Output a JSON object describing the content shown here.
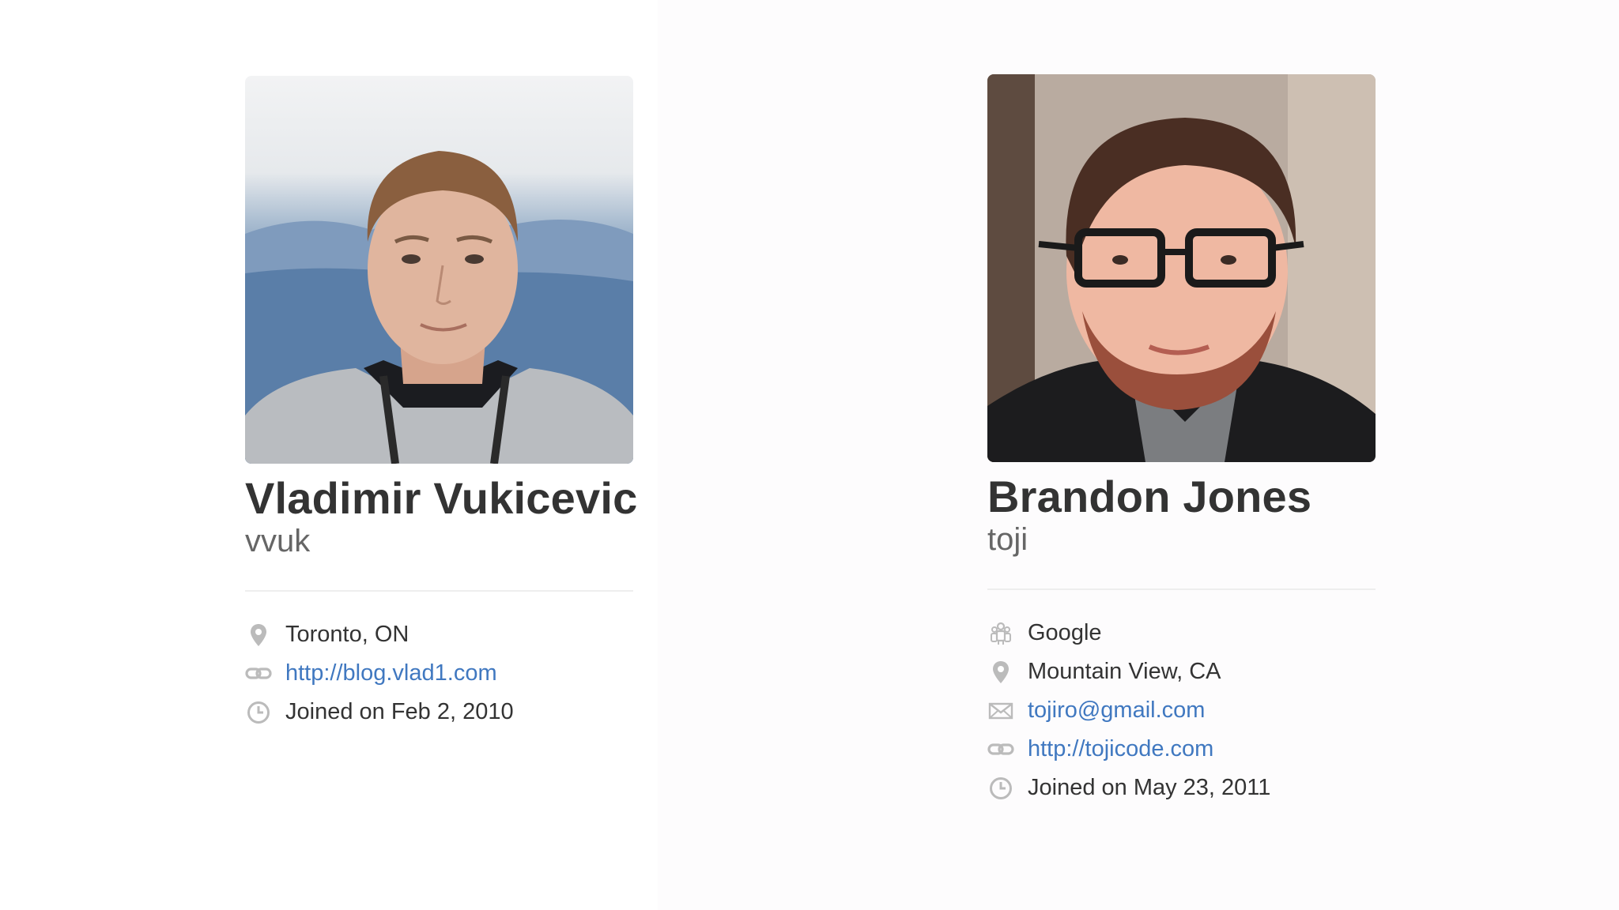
{
  "profiles": [
    {
      "fullname": "Vladimir Vukicevic",
      "username": "vvuk",
      "location": "Toronto, ON",
      "url": "http://blog.vlad1.com",
      "joined": "Joined on Feb 2, 2010",
      "icons": {
        "location": "location-pin-icon",
        "url": "link-icon",
        "joined": "clock-icon"
      }
    },
    {
      "fullname": "Brandon Jones",
      "username": "toji",
      "organization": "Google",
      "location": "Mountain View, CA",
      "email": "tojiro@gmail.com",
      "url": "http://tojicode.com",
      "joined": "Joined on May 23, 2011",
      "icons": {
        "organization": "organization-icon",
        "location": "location-pin-icon",
        "email": "mail-icon",
        "url": "link-icon",
        "joined": "clock-icon"
      }
    }
  ],
  "colors": {
    "link": "#4078c0",
    "text": "#333333",
    "muted": "#666666",
    "icon": "#bbbbbb",
    "divider": "#eeeeee"
  }
}
